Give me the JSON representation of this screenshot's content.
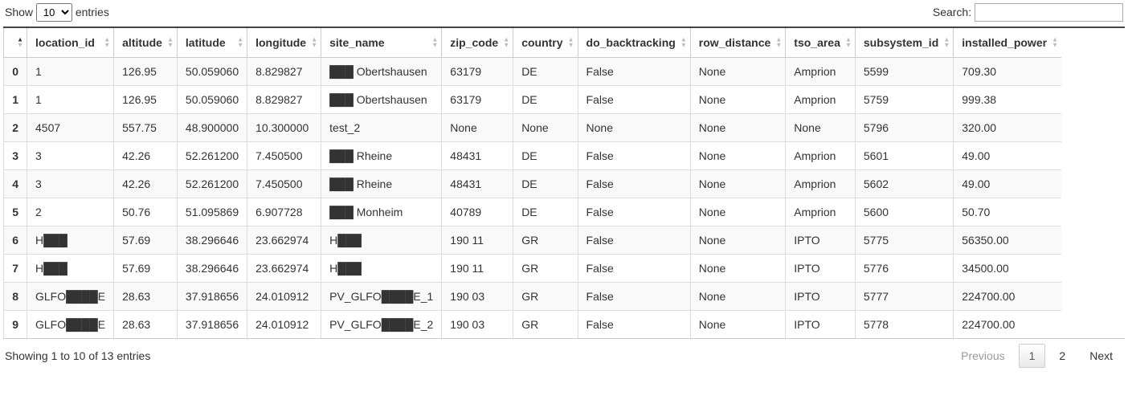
{
  "length_control": {
    "prefix": "Show ",
    "suffix": " entries",
    "selected": "10"
  },
  "search_control": {
    "label": "Search:",
    "value": ""
  },
  "columns": [
    "",
    "location_id",
    "altitude",
    "latitude",
    "longitude",
    "site_name",
    "zip_code",
    "country",
    "do_backtracking",
    "row_distance",
    "tso_area",
    "subsystem_id",
    "installed_power"
  ],
  "sorted_col_index": 0,
  "rows": [
    {
      "idx": "0",
      "location_id": "1",
      "altitude": "126.95",
      "latitude": "50.059060",
      "longitude": "8.829827",
      "site_name": "███ Obertshausen",
      "zip_code": "63179",
      "country": "DE",
      "do_backtracking": "False",
      "row_distance": "None",
      "tso_area": "Amprion",
      "subsystem_id": "5599",
      "installed_power": "709.30"
    },
    {
      "idx": "1",
      "location_id": "1",
      "altitude": "126.95",
      "latitude": "50.059060",
      "longitude": "8.829827",
      "site_name": "███ Obertshausen",
      "zip_code": "63179",
      "country": "DE",
      "do_backtracking": "False",
      "row_distance": "None",
      "tso_area": "Amprion",
      "subsystem_id": "5759",
      "installed_power": "999.38"
    },
    {
      "idx": "2",
      "location_id": "4507",
      "altitude": "557.75",
      "latitude": "48.900000",
      "longitude": "10.300000",
      "site_name": "test_2",
      "zip_code": "None",
      "country": "None",
      "do_backtracking": "None",
      "row_distance": "None",
      "tso_area": "None",
      "subsystem_id": "5796",
      "installed_power": "320.00"
    },
    {
      "idx": "3",
      "location_id": "3",
      "altitude": "42.26",
      "latitude": "52.261200",
      "longitude": "7.450500",
      "site_name": "███ Rheine",
      "zip_code": "48431",
      "country": "DE",
      "do_backtracking": "False",
      "row_distance": "None",
      "tso_area": "Amprion",
      "subsystem_id": "5601",
      "installed_power": "49.00"
    },
    {
      "idx": "4",
      "location_id": "3",
      "altitude": "42.26",
      "latitude": "52.261200",
      "longitude": "7.450500",
      "site_name": "███ Rheine",
      "zip_code": "48431",
      "country": "DE",
      "do_backtracking": "False",
      "row_distance": "None",
      "tso_area": "Amprion",
      "subsystem_id": "5602",
      "installed_power": "49.00"
    },
    {
      "idx": "5",
      "location_id": "2",
      "altitude": "50.76",
      "latitude": "51.095869",
      "longitude": "6.907728",
      "site_name": "███ Monheim",
      "zip_code": "40789",
      "country": "DE",
      "do_backtracking": "False",
      "row_distance": "None",
      "tso_area": "Amprion",
      "subsystem_id": "5600",
      "installed_power": "50.70"
    },
    {
      "idx": "6",
      "location_id": "H███",
      "altitude": "57.69",
      "latitude": "38.296646",
      "longitude": "23.662974",
      "site_name": "H███",
      "zip_code": "190 11",
      "country": "GR",
      "do_backtracking": "False",
      "row_distance": "None",
      "tso_area": "IPTO",
      "subsystem_id": "5775",
      "installed_power": "56350.00"
    },
    {
      "idx": "7",
      "location_id": "H███",
      "altitude": "57.69",
      "latitude": "38.296646",
      "longitude": "23.662974",
      "site_name": "H███",
      "zip_code": "190 11",
      "country": "GR",
      "do_backtracking": "False",
      "row_distance": "None",
      "tso_area": "IPTO",
      "subsystem_id": "5776",
      "installed_power": "34500.00"
    },
    {
      "idx": "8",
      "location_id": "GLFO████E",
      "altitude": "28.63",
      "latitude": "37.918656",
      "longitude": "24.010912",
      "site_name": "PV_GLFO████E_1",
      "zip_code": "190 03",
      "country": "GR",
      "do_backtracking": "False",
      "row_distance": "None",
      "tso_area": "IPTO",
      "subsystem_id": "5777",
      "installed_power": "224700.00"
    },
    {
      "idx": "9",
      "location_id": "GLFO████E",
      "altitude": "28.63",
      "latitude": "37.918656",
      "longitude": "24.010912",
      "site_name": "PV_GLFO████E_2",
      "zip_code": "190 03",
      "country": "GR",
      "do_backtracking": "False",
      "row_distance": "None",
      "tso_area": "IPTO",
      "subsystem_id": "5778",
      "installed_power": "224700.00"
    }
  ],
  "info_text": "Showing 1 to 10 of 13 entries",
  "paginate": {
    "previous": "Previous",
    "next": "Next",
    "pages": [
      "1",
      "2"
    ],
    "current": 0,
    "prev_disabled": true,
    "next_disabled": false
  }
}
